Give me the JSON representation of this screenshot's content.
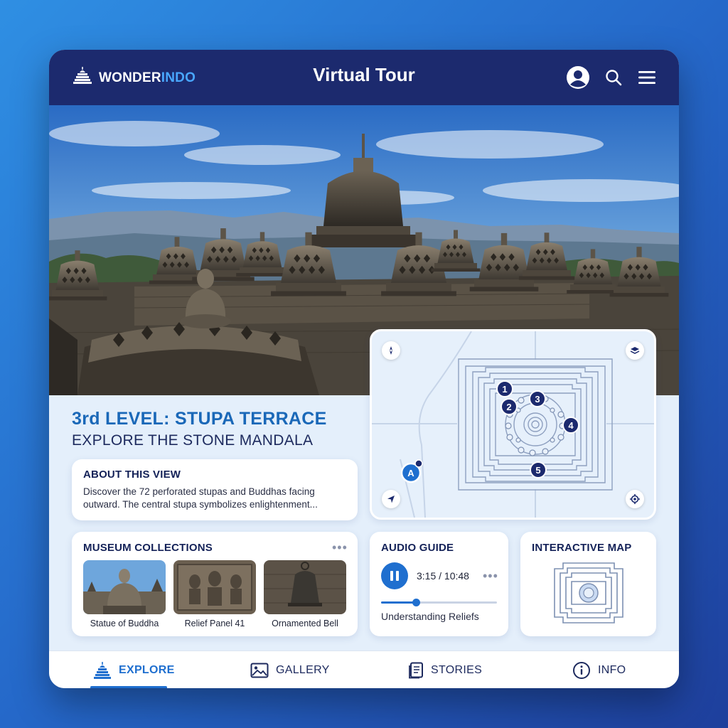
{
  "brand": {
    "part1": "WONDER",
    "part2": "INDO",
    "logo_icon": "stupa-logo-icon"
  },
  "header": {
    "title": "Virtual Tour",
    "icons": [
      "user-avatar-icon",
      "search-icon",
      "menu-icon"
    ]
  },
  "level": {
    "title": "3rd LEVEL: STUPA TERRACE",
    "subtitle": "EXPLORE THE STONE MANDALA"
  },
  "about": {
    "title": "ABOUT THIS VIEW",
    "text": "Discover the 72 perforated stupas and Buddhas facing outward. The central stupa symbolizes enlightenment..."
  },
  "map": {
    "markers": [
      "1",
      "2",
      "3",
      "4",
      "5"
    ],
    "current_location": "A",
    "controls": [
      "compass-icon",
      "layers-icon",
      "navigate-icon",
      "recenter-icon"
    ]
  },
  "museum": {
    "title": "MUSEUM COLLECTIONS",
    "more": "•••",
    "items": [
      {
        "caption": "Statue of Buddha"
      },
      {
        "caption": "Relief Panel 41"
      },
      {
        "caption": "Ornamented Bell"
      }
    ]
  },
  "audio": {
    "title": "AUDIO GUIDE",
    "time": "3:15 / 10:48",
    "more": "•••",
    "track": "Understanding Reliefs",
    "progress": 0.3
  },
  "interactive_map": {
    "title": "INTERACTIVE MAP"
  },
  "nav": {
    "items": [
      {
        "label": "EXPLORE",
        "icon": "stupa-icon",
        "active": true
      },
      {
        "label": "GALLERY",
        "icon": "image-icon",
        "active": false
      },
      {
        "label": "STORIES",
        "icon": "document-icon",
        "active": false
      },
      {
        "label": "INFO",
        "icon": "info-icon",
        "active": false
      }
    ]
  },
  "colors": {
    "header": "#1c2a6e",
    "accent": "#1f6fcf",
    "title_blue": "#1a68b8",
    "brand_light": "#49a7ff"
  }
}
